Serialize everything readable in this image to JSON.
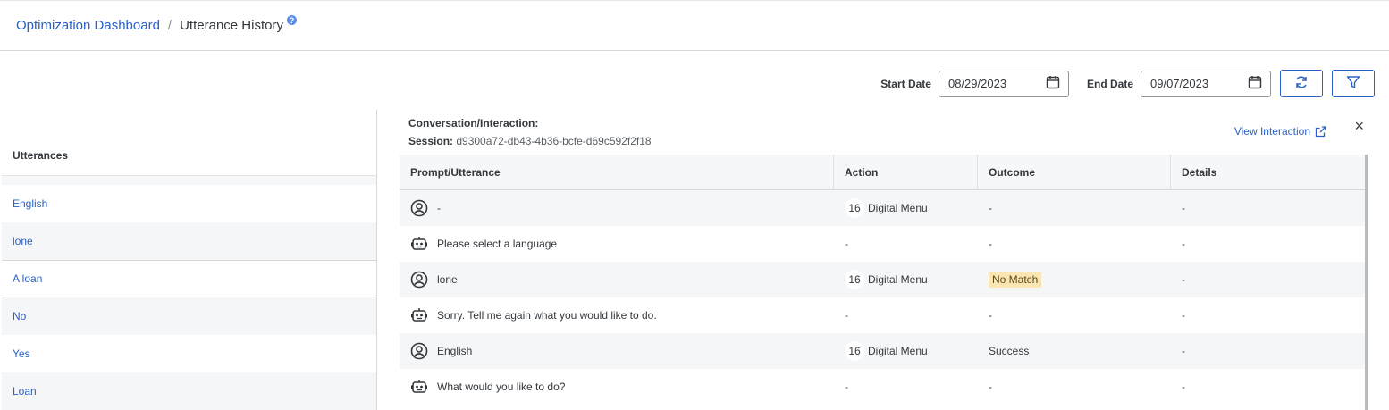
{
  "breadcrumb": {
    "link": "Optimization Dashboard",
    "separator": "/",
    "current": "Utterance History",
    "help_glyph": "?"
  },
  "filters": {
    "start_label": "Start Date",
    "start_value": "08/29/2023",
    "end_label": "End Date",
    "end_value": "09/07/2023"
  },
  "utterances": {
    "header": "Utterances",
    "items": [
      {
        "label": "English"
      },
      {
        "label": "lone"
      },
      {
        "label": "A loan"
      },
      {
        "label": "No"
      },
      {
        "label": "Yes"
      },
      {
        "label": "Loan"
      }
    ]
  },
  "detail": {
    "title": "Conversation/Interaction:",
    "session_label": "Session:",
    "session_value": "d9300a72-db43-4b36-bcfe-d69c592f2f18",
    "view_link": "View Interaction",
    "close_glyph": "×",
    "columns": [
      "Prompt/Utterance",
      "Action",
      "Outcome",
      "Details"
    ],
    "rows": [
      {
        "icon": "user-icon",
        "text": "-",
        "action_num": "16",
        "action": "Digital Menu",
        "outcome": "-",
        "details": "-"
      },
      {
        "icon": "bot-icon",
        "text": "Please select a language",
        "action_num": "",
        "action": "-",
        "outcome": "-",
        "details": "-"
      },
      {
        "icon": "user-icon",
        "text": "lone",
        "action_num": "16",
        "action": "Digital Menu",
        "outcome": "No Match",
        "details": "-"
      },
      {
        "icon": "bot-icon",
        "text": "Sorry. Tell me again what you would like to do.",
        "action_num": "",
        "action": "-",
        "outcome": "-",
        "details": "-"
      },
      {
        "icon": "user-icon",
        "text": "English",
        "action_num": "16",
        "action": "Digital Menu",
        "outcome": "Success",
        "details": "-"
      },
      {
        "icon": "bot-icon",
        "text": "What would you like to do?",
        "action_num": "",
        "action": "-",
        "outcome": "-",
        "details": "-"
      }
    ]
  },
  "colors": {
    "link": "#2a60c8",
    "no_match_bg": "#fbe5b3"
  }
}
